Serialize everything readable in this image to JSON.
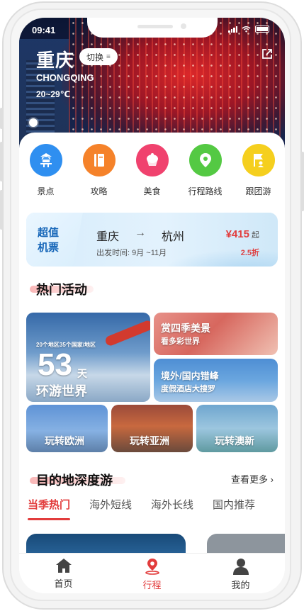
{
  "status": {
    "time": "09:41"
  },
  "header": {
    "city": "重庆",
    "switch_label": "切换",
    "switch_icon": "list-icon",
    "city_en": "CHONGQING",
    "temperature": "20~29℃",
    "weather_icon": "sun-icon",
    "share_icon": "share-icon"
  },
  "categories": [
    {
      "label": "景点",
      "icon": "pagoda-icon",
      "color": "#2f8ff0"
    },
    {
      "label": "攻略",
      "icon": "book-icon",
      "color": "#f5822a"
    },
    {
      "label": "美食",
      "icon": "cupcake-icon",
      "color": "#f0426e"
    },
    {
      "label": "行程路线",
      "icon": "map-pin-icon",
      "color": "#54c943"
    },
    {
      "label": "跟团游",
      "icon": "flag-group-icon",
      "color": "#f5cf1e"
    }
  ],
  "flight": {
    "tag_line1": "超值",
    "tag_line2": "机票",
    "from": "重庆",
    "arrow": "→",
    "to": "杭州",
    "depart_label": "出发时间:",
    "depart_range": "9月 ~11月",
    "price": "¥415",
    "price_suffix": "起",
    "discount": "2.5折"
  },
  "hot": {
    "title": "热门活动",
    "big_tile": {
      "caption": "20个地区35个国家/地区",
      "number": "53",
      "unit": "天",
      "title": "环游世界"
    },
    "tile_season": {
      "title": "赏四季美景",
      "subtitle": "看多彩世界"
    },
    "tile_hotel": {
      "title": "境外/国内错峰",
      "subtitle": "度假酒店大搜罗"
    },
    "tile_europe": "玩转欧洲",
    "tile_asia": "玩转亚洲",
    "tile_aus": "玩转澳新"
  },
  "destination": {
    "title": "目的地深度游",
    "more": "查看更多",
    "tabs": [
      "当季热门",
      "海外短线",
      "海外长线",
      "国内推荐"
    ],
    "active_tab": 0
  },
  "tabbar": [
    {
      "label": "首页",
      "icon": "home-icon"
    },
    {
      "label": "行程",
      "icon": "route-pin-icon",
      "active": true
    },
    {
      "label": "我的",
      "icon": "user-icon"
    }
  ],
  "colors": {
    "accent": "#e23c3c",
    "flight_blue": "#1565b8"
  }
}
